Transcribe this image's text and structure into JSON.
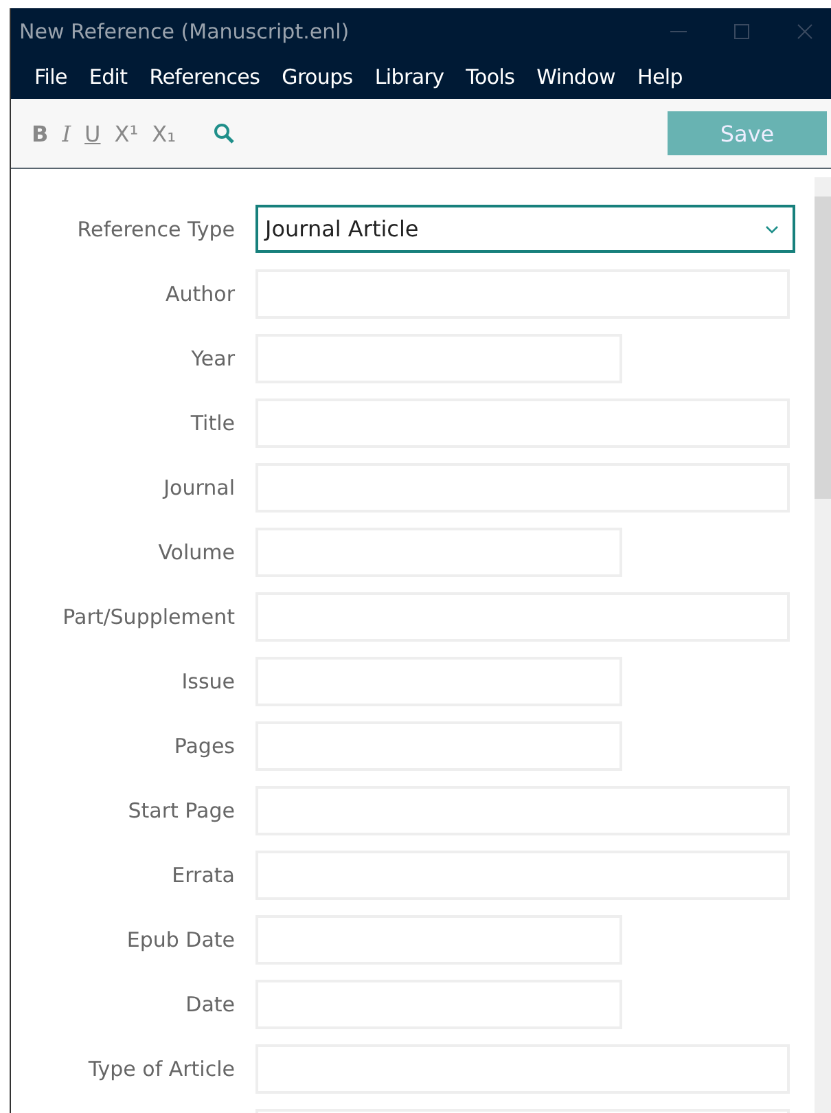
{
  "window": {
    "title": "New Reference (Manuscript.enl)"
  },
  "menu": [
    "File",
    "Edit",
    "References",
    "Groups",
    "Library",
    "Tools",
    "Window",
    "Help"
  ],
  "toolbar": {
    "format_buttons": [
      "B",
      "I",
      "U",
      "X¹",
      "X₁"
    ],
    "save": "Save"
  },
  "fields": [
    {
      "label": "Reference Type",
      "kind": "select",
      "value": "Journal Article"
    },
    {
      "label": "Author",
      "kind": "wide"
    },
    {
      "label": "Year",
      "kind": "short"
    },
    {
      "label": "Title",
      "kind": "wide"
    },
    {
      "label": "Journal",
      "kind": "wide"
    },
    {
      "label": "Volume",
      "kind": "short"
    },
    {
      "label": "Part/Supplement",
      "kind": "wide"
    },
    {
      "label": "Issue",
      "kind": "short"
    },
    {
      "label": "Pages",
      "kind": "short"
    },
    {
      "label": "Start Page",
      "kind": "wide"
    },
    {
      "label": "Errata",
      "kind": "wide"
    },
    {
      "label": "Epub Date",
      "kind": "short"
    },
    {
      "label": "Date",
      "kind": "short"
    },
    {
      "label": "Type of Article",
      "kind": "wide"
    },
    {
      "kind": "wide"
    }
  ]
}
